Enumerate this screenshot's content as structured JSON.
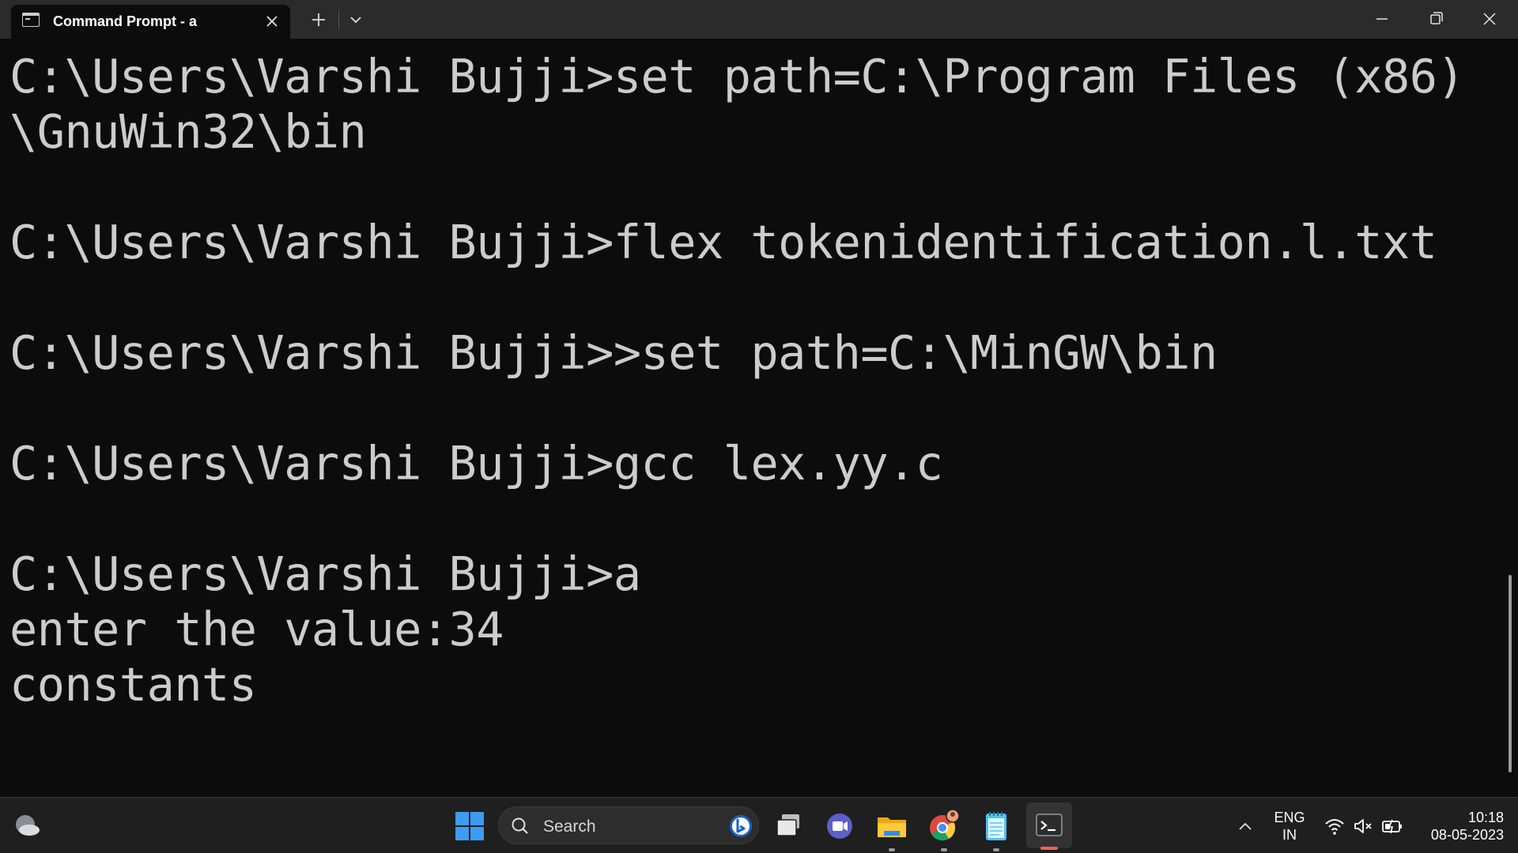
{
  "window": {
    "tab_title": "Command Prompt - a"
  },
  "console": {
    "lines": [
      "C:\\Users\\Varshi Bujji>set path=C:\\Program Files (x86)",
      "\\GnuWin32\\bin",
      "",
      "C:\\Users\\Varshi Bujji>flex tokenidentification.l.txt",
      "",
      "C:\\Users\\Varshi Bujji>>set path=C:\\MinGW\\bin",
      "",
      "C:\\Users\\Varshi Bujji>gcc lex.yy.c",
      "",
      "C:\\Users\\Varshi Bujji>a",
      "enter the value:34",
      "constants"
    ]
  },
  "taskbar": {
    "search_label": "Search",
    "lang_line1": "ENG",
    "lang_line2": "IN",
    "time": "10:18",
    "date": "08-05-2023",
    "colors": {
      "accent_windows": "#3a9cf4",
      "terminal_indicator": "#ff5c5c"
    }
  }
}
